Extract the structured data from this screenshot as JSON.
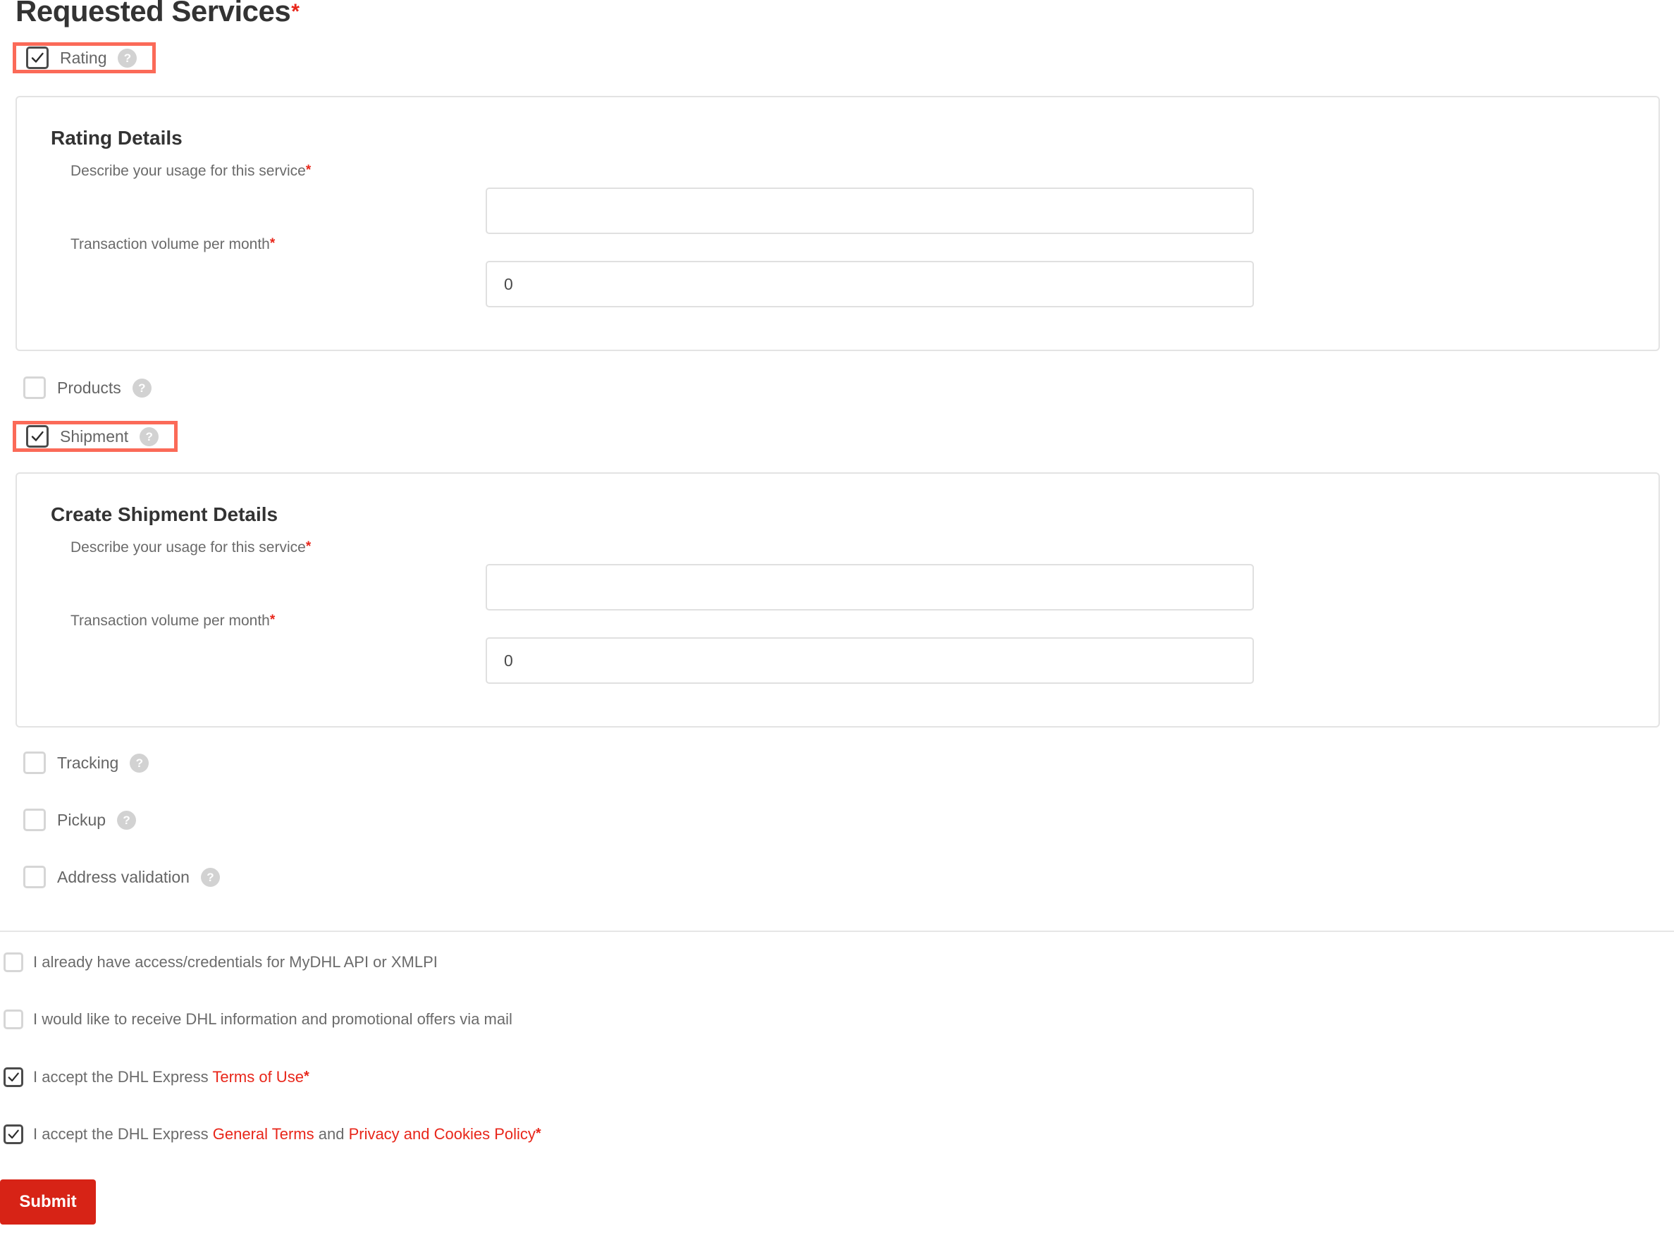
{
  "section": {
    "title": "Requested Services",
    "required_marker": "*"
  },
  "help_icon_glyph": "?",
  "colors": {
    "brand_red": "#d72316",
    "required_star": "#e8261a",
    "link_red": "#e8261a",
    "highlight_outline": "#fb6a58",
    "panel_border": "#e3e3e3",
    "input_border": "#e0e0e0",
    "checkbox_off_border": "#d6d6d6",
    "checkbox_on_border": "#4b4b4b",
    "label_text": "#6b6b6b",
    "heading_text": "#333333"
  },
  "services": [
    {
      "id": "rating",
      "label": "Rating",
      "checked": true,
      "highlighted": true,
      "help": "?"
    },
    {
      "id": "products",
      "label": "Products",
      "checked": false,
      "highlighted": false,
      "help": "?"
    },
    {
      "id": "shipment",
      "label": "Shipment",
      "checked": true,
      "highlighted": true,
      "help": "?"
    },
    {
      "id": "tracking",
      "label": "Tracking",
      "checked": false,
      "highlighted": false,
      "help": "?"
    },
    {
      "id": "pickup",
      "label": "Pickup",
      "checked": false,
      "highlighted": false,
      "help": "?"
    },
    {
      "id": "address_validation",
      "label": "Address validation",
      "checked": false,
      "highlighted": false,
      "help": "?"
    }
  ],
  "rating_details": {
    "heading": "Rating Details",
    "usage_label": "Describe your usage for this service",
    "usage_required": "*",
    "usage_value": "",
    "usage_placeholder": "",
    "volume_label": "Transaction volume per month",
    "volume_required": "*",
    "volume_value": "0",
    "volume_placeholder": ""
  },
  "shipment_details": {
    "heading": "Create Shipment Details",
    "usage_label": "Describe your usage for this service",
    "usage_required": "*",
    "usage_value": "",
    "usage_placeholder": "",
    "volume_label": "Transaction volume per month",
    "volume_required": "*",
    "volume_value": "0",
    "volume_placeholder": ""
  },
  "consents": [
    {
      "id": "existing_credentials",
      "checked": false,
      "text": "I already have access/credentials for MyDHL API or XMLPI"
    },
    {
      "id": "promotional_offers",
      "checked": false,
      "text": "I would like to receive DHL information and promotional offers via mail"
    }
  ],
  "terms": {
    "terms_of_use": {
      "id": "accept_terms_of_use",
      "checked": true,
      "prefix": "I accept the DHL Express ",
      "link1": "Terms of Use",
      "required": "*"
    },
    "general_terms": {
      "id": "accept_general_terms",
      "checked": true,
      "prefix": "I accept the DHL Express ",
      "link1": "General Terms",
      "middle": " and ",
      "link2": "Privacy and Cookies Policy",
      "required": "*"
    }
  },
  "submit": {
    "label": "Submit"
  }
}
